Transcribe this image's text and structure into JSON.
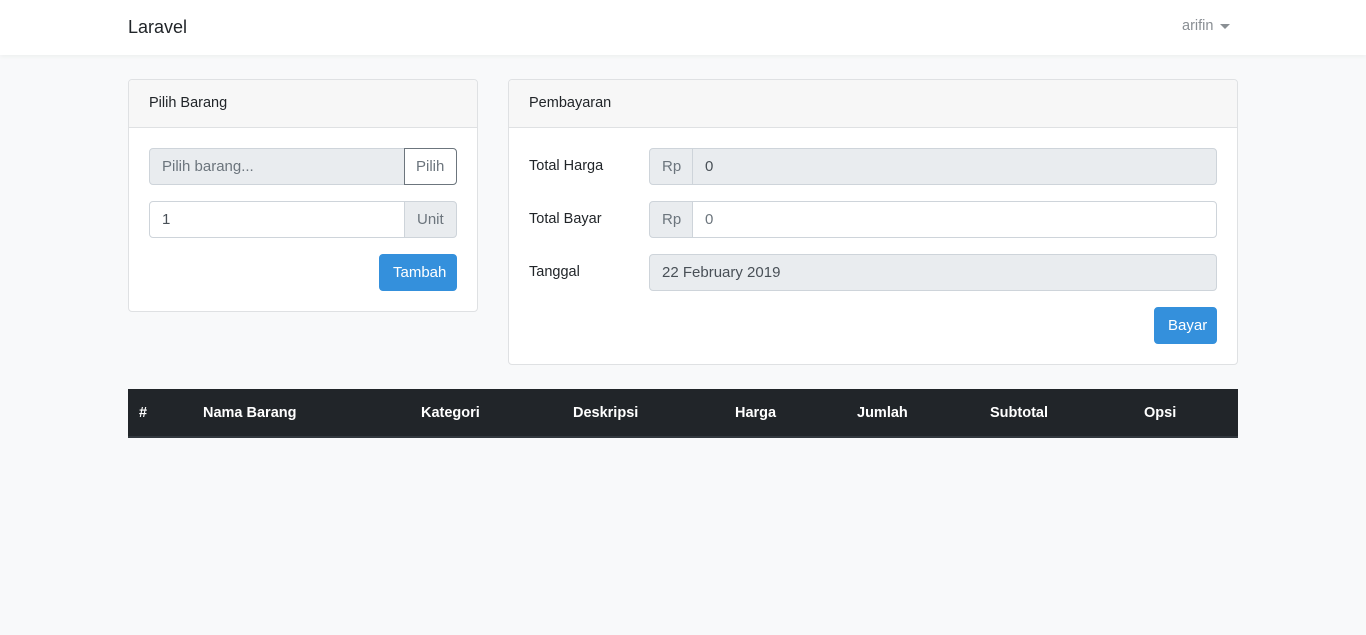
{
  "navbar": {
    "brand": "Laravel",
    "user": "arifin"
  },
  "pilih_barang": {
    "title": "Pilih Barang",
    "item_placeholder": "Pilih barang...",
    "pilih_button": "Pilih",
    "qty_value": "1",
    "unit_label": "Unit",
    "add_button": "Tambah"
  },
  "pembayaran": {
    "title": "Pembayaran",
    "total_harga_label": "Total Harga",
    "total_harga_currency": "Rp",
    "total_harga_value": "0",
    "total_bayar_label": "Total Bayar",
    "total_bayar_currency": "Rp",
    "total_bayar_placeholder": "0",
    "tanggal_label": "Tanggal",
    "tanggal_value": "22 February 2019",
    "pay_button": "Bayar"
  },
  "table": {
    "columns": [
      "#",
      "Nama Barang",
      "Kategori",
      "Deskripsi",
      "Harga",
      "Jumlah",
      "Subtotal",
      "Opsi"
    ],
    "rows": []
  }
}
